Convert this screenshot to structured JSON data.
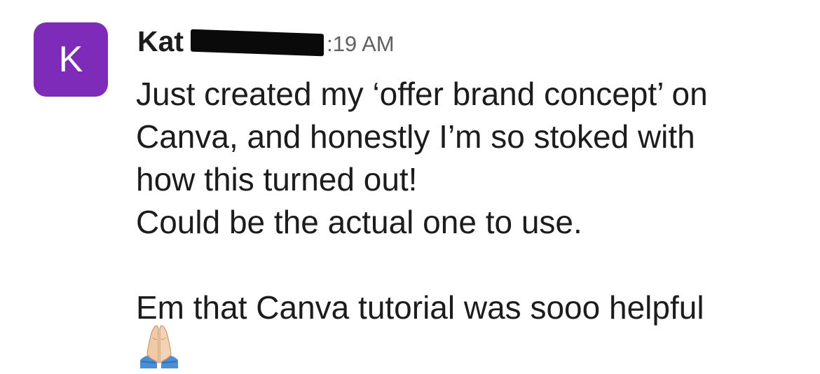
{
  "avatar": {
    "letter": "K",
    "color": "#7d2bb8"
  },
  "message": {
    "sender": "Kat",
    "timestamp": ":19 AM",
    "lines": [
      "Just created my ‘offer brand concept’ on",
      "Canva, and honestly I’m so stoked with",
      "how this turned out!",
      "Could be the actual one to use.",
      "",
      "Em that Canva tutorial was sooo helpful"
    ],
    "reaction_emoji": "folded-hands"
  }
}
